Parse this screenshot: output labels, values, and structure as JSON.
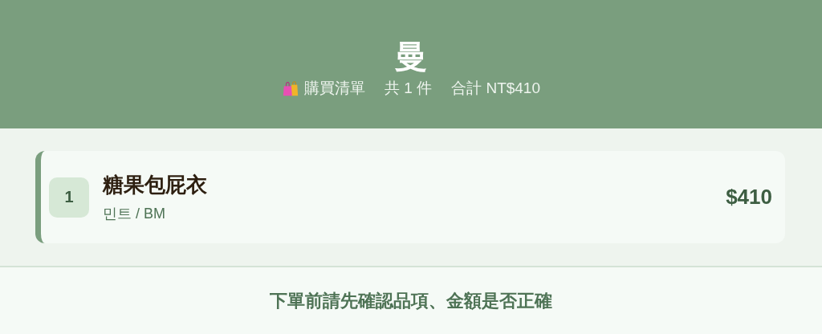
{
  "header": {
    "title": "曼",
    "list_label": "購買清單",
    "count": "共 1 件",
    "total": "合計 NT$410"
  },
  "items": [
    {
      "number": "1",
      "name": "糖果包屁衣",
      "variant": "민트 / BM",
      "price": "$410"
    }
  ],
  "footer": {
    "notice": "下單前請先確認品項、金額是否正確"
  }
}
